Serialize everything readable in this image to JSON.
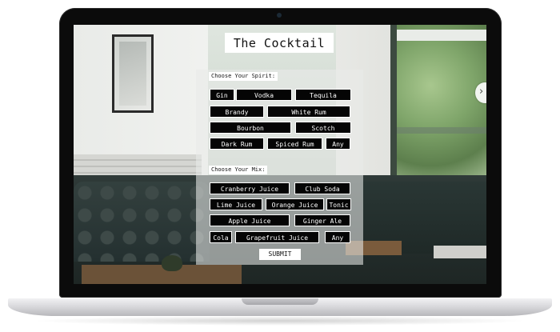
{
  "app": {
    "title": "The Cocktail"
  },
  "spirits": {
    "label": "Choose Your Spirit:",
    "options": [
      "Gin",
      "Vodka",
      "Tequila",
      "Brandy",
      "White Rum",
      "Bourbon",
      "Scotch",
      "Dark Rum",
      "Spiced Rum",
      "Any"
    ]
  },
  "mixes": {
    "label": "Choose Your Mix:",
    "options": [
      "Cranberry Juice",
      "Club Soda",
      "Lime Juice",
      "Orange Juice",
      "Tonic",
      "Apple Juice",
      "Ginger Ale",
      "Cola",
      "Grapefruit Juice",
      "Any"
    ]
  },
  "submit_label": "SUBMIT",
  "icons": {
    "scroll_arrow": "chevron-right-icon"
  },
  "colors": {
    "chip_bg": "#050505",
    "chip_text": "#ffffff",
    "panel_bg": "rgba(232,235,232,0.58)"
  }
}
